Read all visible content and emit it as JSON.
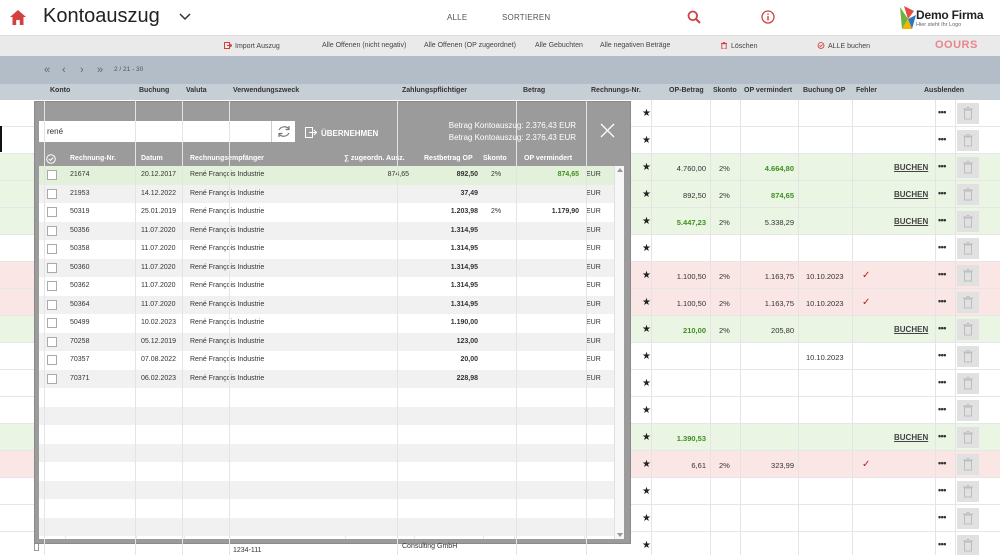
{
  "header": {
    "title": "Kontoauszug",
    "nav": [
      "ALLE",
      "SORTIEREN"
    ],
    "logo": {
      "name": "Demo Firma",
      "tagline": "Hier steht Ihr Logo"
    }
  },
  "toolbar": {
    "import": "Import Auszug",
    "open_not_negative": "Alle Offenen (nicht negativ)",
    "open_assigned": "Alle Offenen (OP zugeordnet)",
    "booked": "Alle Gebuchten",
    "negative": "Alle negativen Beträge",
    "delete": "Löschen",
    "book_all": "ALLE buchen",
    "brand": "OOURS",
    "brand_color": "#e8868c"
  },
  "pager": {
    "first": "«",
    "prev": "‹",
    "next": "›",
    "last": "»",
    "text": "2 / 21 - 30"
  },
  "main_table": {
    "columns": [
      "Konto",
      "Buchung",
      "Valuta",
      "Verwendungszweck",
      "Zahlungspflichtiger",
      "Betrag",
      "Rechnungs-Nr.",
      "OP-Betrag",
      "Skonto",
      "OP vermindert",
      "Buchung OP",
      "Fehler",
      "Ausblenden"
    ],
    "rows": [
      {
        "state": "",
        "op_betrag": "",
        "skonto": "",
        "op_vermindert": "",
        "buchung_op": "",
        "fehler": "",
        "action": ""
      },
      {
        "state": "",
        "op_betrag": "",
        "skonto": "",
        "op_vermindert": "",
        "buchung_op": "",
        "fehler": "",
        "action": ""
      },
      {
        "state": "green",
        "op_betrag": "4.760,00",
        "skonto": "2%",
        "op_vermindert": "4.664,80",
        "op_vermindert_green": true,
        "buchung_op": "",
        "fehler": "",
        "action": "BUCHEN"
      },
      {
        "state": "green",
        "op_betrag": "892,50",
        "skonto": "2%",
        "op_vermindert": "874,65",
        "op_vermindert_green": true,
        "buchung_op": "",
        "fehler": "",
        "action": "BUCHEN"
      },
      {
        "state": "green",
        "op_betrag": "5.447,23",
        "op_betrag_green": true,
        "skonto": "2%",
        "op_vermindert": "5.338,29",
        "buchung_op": "",
        "fehler": "",
        "action": "BUCHEN"
      },
      {
        "state": "",
        "op_betrag": "",
        "skonto": "",
        "op_vermindert": "",
        "buchung_op": "",
        "fehler": "",
        "action": ""
      },
      {
        "state": "red",
        "op_betrag": "1.100,50",
        "skonto": "2%",
        "op_vermindert": "1.163,75",
        "buchung_op": "10.10.2023",
        "fehler": "✓",
        "action": ""
      },
      {
        "state": "red",
        "op_betrag": "1.100,50",
        "skonto": "2%",
        "op_vermindert": "1.163,75",
        "buchung_op": "10.10.2023",
        "fehler": "✓",
        "action": ""
      },
      {
        "state": "green",
        "op_betrag": "210,00",
        "op_betrag_green": true,
        "skonto": "2%",
        "op_vermindert": "205,80",
        "buchung_op": "",
        "fehler": "",
        "action": "BUCHEN"
      },
      {
        "state": "",
        "op_betrag": "",
        "skonto": "",
        "op_vermindert": "",
        "buchung_op": "10.10.2023",
        "fehler": "",
        "action": ""
      },
      {
        "state": "",
        "op_betrag": "",
        "skonto": "",
        "op_vermindert": "",
        "buchung_op": "",
        "fehler": "",
        "action": ""
      },
      {
        "state": "",
        "op_betrag": "",
        "skonto": "",
        "op_vermindert": "",
        "buchung_op": "",
        "fehler": "",
        "action": ""
      },
      {
        "state": "green",
        "op_betrag": "1.390,53",
        "op_betrag_green": true,
        "skonto": "",
        "op_vermindert": "",
        "buchung_op": "",
        "fehler": "",
        "action": "BUCHEN"
      },
      {
        "state": "red",
        "op_betrag": "6,61",
        "skonto": "2%",
        "op_vermindert": "323,99",
        "buchung_op": "",
        "fehler": "✓",
        "action": ""
      },
      {
        "state": "",
        "op_betrag": "",
        "skonto": "",
        "op_vermindert": "",
        "buchung_op": "",
        "fehler": "",
        "action": ""
      },
      {
        "state": "",
        "op_betrag": "",
        "skonto": "",
        "op_vermindert": "",
        "buchung_op": "",
        "fehler": "",
        "action": ""
      },
      {
        "state": "",
        "op_betrag": "",
        "skonto": "",
        "op_vermindert": "",
        "buchung_op": "",
        "fehler": "",
        "action": ""
      }
    ],
    "partial_bottom": {
      "verwendungszweck": "1234-111",
      "zahlungspflichtiger": "Consulting GmbH"
    }
  },
  "overlay": {
    "search_value": "rené",
    "accept_label": "ÜBERNEHMEN",
    "sum_1": "Betrag Kontoauszug: 2.376,43 EUR",
    "sum_2": "Betrag Kontoauszug: 2.376,43 EUR",
    "columns": [
      "Rechnung-Nr.",
      "Datum",
      "Rechnungsempfänger",
      "∑ zugeordn. Ausz.",
      "Restbetrag OP",
      "Skonto",
      "OP vermindert"
    ],
    "rows": [
      {
        "nr": "21674",
        "datum": "20.12.2017",
        "empf": "René François Industrie",
        "zug": "874,65",
        "rest": "892,50",
        "skonto": "2%",
        "opv": "874,65",
        "cur": "EUR",
        "highlight": true
      },
      {
        "nr": "21953",
        "datum": "14.12.2022",
        "empf": "René François Industrie",
        "zug": "",
        "rest": "37,49",
        "skonto": "",
        "opv": "",
        "cur": "EUR"
      },
      {
        "nr": "50319",
        "datum": "25.01.2019",
        "empf": "René François Industrie",
        "zug": "",
        "rest": "1.203,98",
        "skonto": "2%",
        "opv": "1.179,90",
        "cur": "EUR"
      },
      {
        "nr": "50356",
        "datum": "11.07.2020",
        "empf": "René François Industrie",
        "zug": "",
        "rest": "1.314,95",
        "skonto": "",
        "opv": "",
        "cur": "EUR"
      },
      {
        "nr": "50358",
        "datum": "11.07.2020",
        "empf": "René François Industrie",
        "zug": "",
        "rest": "1.314,95",
        "skonto": "",
        "opv": "",
        "cur": "EUR"
      },
      {
        "nr": "50360",
        "datum": "11.07.2020",
        "empf": "René François Industrie",
        "zug": "",
        "rest": "1.314,95",
        "skonto": "",
        "opv": "",
        "cur": "EUR"
      },
      {
        "nr": "50362",
        "datum": "11.07.2020",
        "empf": "René François Industrie",
        "zug": "",
        "rest": "1.314,95",
        "skonto": "",
        "opv": "",
        "cur": "EUR"
      },
      {
        "nr": "50364",
        "datum": "11.07.2020",
        "empf": "René François Industrie",
        "zug": "",
        "rest": "1.314,95",
        "skonto": "",
        "opv": "",
        "cur": "EUR"
      },
      {
        "nr": "50499",
        "datum": "10.02.2023",
        "empf": "René François Industrie",
        "zug": "",
        "rest": "1.190,00",
        "skonto": "",
        "opv": "",
        "cur": "EUR"
      },
      {
        "nr": "70258",
        "datum": "05.12.2019",
        "empf": "René François Industrie",
        "zug": "",
        "rest": "123,00",
        "skonto": "",
        "opv": "",
        "cur": "EUR"
      },
      {
        "nr": "70357",
        "datum": "07.08.2022",
        "empf": "René François Industrie",
        "zug": "",
        "rest": "20,00",
        "skonto": "",
        "opv": "",
        "cur": "EUR"
      },
      {
        "nr": "70371",
        "datum": "06.02.2023",
        "empf": "René François Industrie",
        "zug": "",
        "rest": "228,98",
        "skonto": "",
        "opv": "",
        "cur": "EUR"
      }
    ]
  },
  "colors": {
    "accent": "#d2413f",
    "green": "#3f8f1f",
    "row_green": "#eaf5e3",
    "row_red": "#fbe6e6",
    "pager_bg": "#b3bdc8"
  }
}
